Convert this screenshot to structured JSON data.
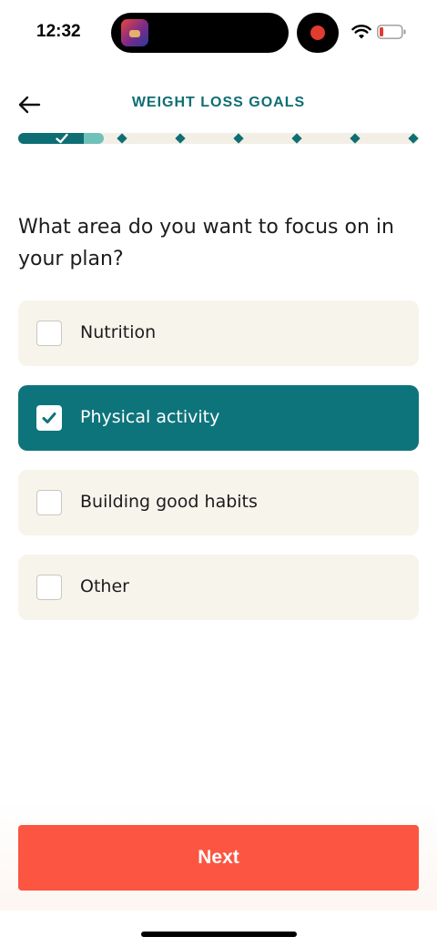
{
  "status_bar": {
    "time": "12:32"
  },
  "header": {
    "title": "WEIGHT LOSS GOALS"
  },
  "progress": {
    "total_steps": 7,
    "current_step": 1,
    "fraction": 0.16
  },
  "question": "What area do you want to focus on in your plan?",
  "options": [
    {
      "label": "Nutrition",
      "checked": false
    },
    {
      "label": "Physical activity",
      "checked": true
    },
    {
      "label": "Building good habits",
      "checked": false
    },
    {
      "label": "Other",
      "checked": false
    }
  ],
  "next_label": "Next",
  "colors": {
    "brand_teal": "#0e6e73",
    "selected_bg": "#0e747b",
    "option_bg": "#f7f4ec",
    "cta": "#fc5541",
    "progress_tail": "#6fc1b9"
  },
  "icons": {
    "back": "arrow-left-icon",
    "check": "checkmark-icon",
    "wifi": "wifi-icon",
    "battery": "battery-low-icon"
  }
}
